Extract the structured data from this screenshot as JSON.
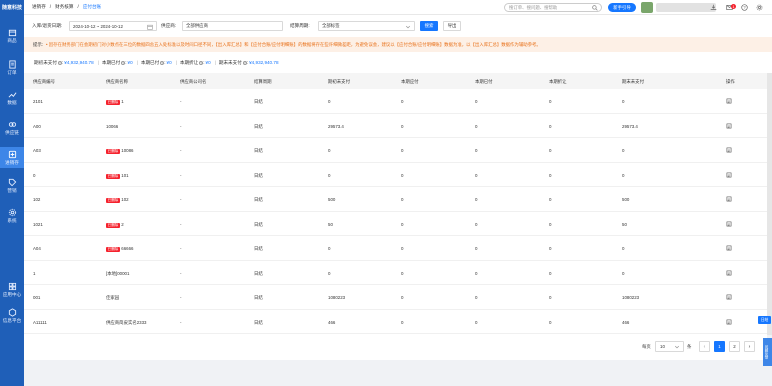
{
  "app": {
    "logo": "随意科技"
  },
  "nav": [
    {
      "label": "商品",
      "icon": "box-icon"
    },
    {
      "label": "订单",
      "icon": "order-icon"
    },
    {
      "label": "数据",
      "icon": "chart-icon"
    },
    {
      "label": "供应链",
      "icon": "link-icon"
    },
    {
      "label": "进销存",
      "icon": "inventory-icon",
      "active": true
    },
    {
      "label": "营销",
      "icon": "tag-icon"
    },
    {
      "label": "系统",
      "icon": "gear-icon"
    },
    {
      "label": "应用中心",
      "icon": "apps-icon"
    },
    {
      "label": "信息平台",
      "icon": "info-icon"
    }
  ],
  "breadcrumb": [
    "进销存",
    "财务核算",
    "应付台账"
  ],
  "header": {
    "search_placeholder": "搜订单、搜问题、搜帮助",
    "guide_label": "新手引导",
    "msg_badge": "1"
  },
  "filters": {
    "date_label": "入库/退货日期:",
    "date_value": "2024-10-12 ~ 2024-10-12",
    "supplier_label": "供应商:",
    "supplier_value": "全部供应商",
    "settle_label": "结算周期:",
    "settle_value": "全部标签",
    "search_btn": "搜索",
    "export_btn": "导出"
  },
  "tip": {
    "label": "提示:",
    "text": "• 因存在财务部门在会期初门对小数点在三位的数据四舍五入处标准以及时间口径不同，【出入库汇总】和【应付合账/应付明细账】的数据将存在些许细微差距，为避免误会，建议以【应付合账/应付明细账】数据为准，以【出入库汇总】数据作为辅助参考。"
  },
  "summary": [
    {
      "label": "期初未支付",
      "value": "¥4,932,940.78"
    },
    {
      "label": "本期已付",
      "value": "¥0"
    },
    {
      "label": "本期已付",
      "value": "¥0"
    },
    {
      "label": "本期折让",
      "value": "¥0"
    },
    {
      "label": "期末未支付",
      "value": "¥4,932,940.78"
    }
  ],
  "table": {
    "columns": [
      "供应商编号",
      "供应商名称",
      "供应商公司名",
      "结算周期",
      "期初未支付",
      "本期应付",
      "本期已付",
      "本期折让",
      "期末未支付",
      "操作"
    ],
    "tag_label": "已删除",
    "rows": [
      {
        "code": "2101",
        "name": "1",
        "tag": true,
        "company": "-",
        "cycle": "日结",
        "open": "0",
        "payable": "0",
        "paid": "0",
        "discount": "0",
        "close": "0"
      },
      {
        "code": "A00",
        "name": "10066",
        "tag": false,
        "company": "-",
        "cycle": "日结",
        "open": "29573.4",
        "payable": "0",
        "paid": "0",
        "discount": "0",
        "close": "29573.4"
      },
      {
        "code": "A03",
        "name": "10086",
        "tag": true,
        "company": "-",
        "cycle": "日结",
        "open": "0",
        "payable": "0",
        "paid": "0",
        "discount": "0",
        "close": "0"
      },
      {
        "code": "0",
        "name": "101",
        "tag": true,
        "company": "-",
        "cycle": "日结",
        "open": "0",
        "payable": "0",
        "paid": "0",
        "discount": "0",
        "close": "0"
      },
      {
        "code": "102",
        "name": "102",
        "tag": true,
        "company": "-",
        "cycle": "日结",
        "open": "500",
        "payable": "0",
        "paid": "0",
        "discount": "0",
        "close": "500"
      },
      {
        "code": "1021",
        "name": "2",
        "tag": true,
        "company": "-",
        "cycle": "日结",
        "open": "50",
        "payable": "0",
        "paid": "0",
        "discount": "0",
        "close": "50"
      },
      {
        "code": "A04",
        "name": "66666",
        "tag": true,
        "company": "-",
        "cycle": "日结",
        "open": "0",
        "payable": "0",
        "paid": "0",
        "discount": "0",
        "close": "0"
      },
      {
        "code": "1",
        "name": "[本地]00001",
        "tag": false,
        "company": "-",
        "cycle": "日结",
        "open": "0",
        "payable": "0",
        "paid": "0",
        "discount": "0",
        "close": "0"
      },
      {
        "code": "001",
        "name": "佳家园",
        "tag": false,
        "company": "-",
        "cycle": "日结",
        "open": "1080223",
        "payable": "0",
        "paid": "0",
        "discount": "0",
        "close": "1080223"
      },
      {
        "code": "A11111",
        "name": "供应商简皮实名2333",
        "tag": false,
        "company": "-",
        "cycle": "日结",
        "open": "466",
        "payable": "0",
        "paid": "0",
        "discount": "0",
        "close": "466"
      }
    ]
  },
  "pagination": {
    "per_page_label": "每页",
    "per_page_value": "10",
    "unit": "条",
    "pages": [
      "1",
      "2"
    ],
    "current": "1",
    "prev": "‹",
    "next": "›"
  },
  "floating": {
    "day_label": "日结",
    "feedback": "问题反馈"
  },
  "colors": {
    "primary": "#1677ff",
    "sidebar": "#1f5fb8",
    "danger": "#f5222d",
    "tip_bg": "#fdf0e6",
    "tip_text": "#e8711a"
  }
}
